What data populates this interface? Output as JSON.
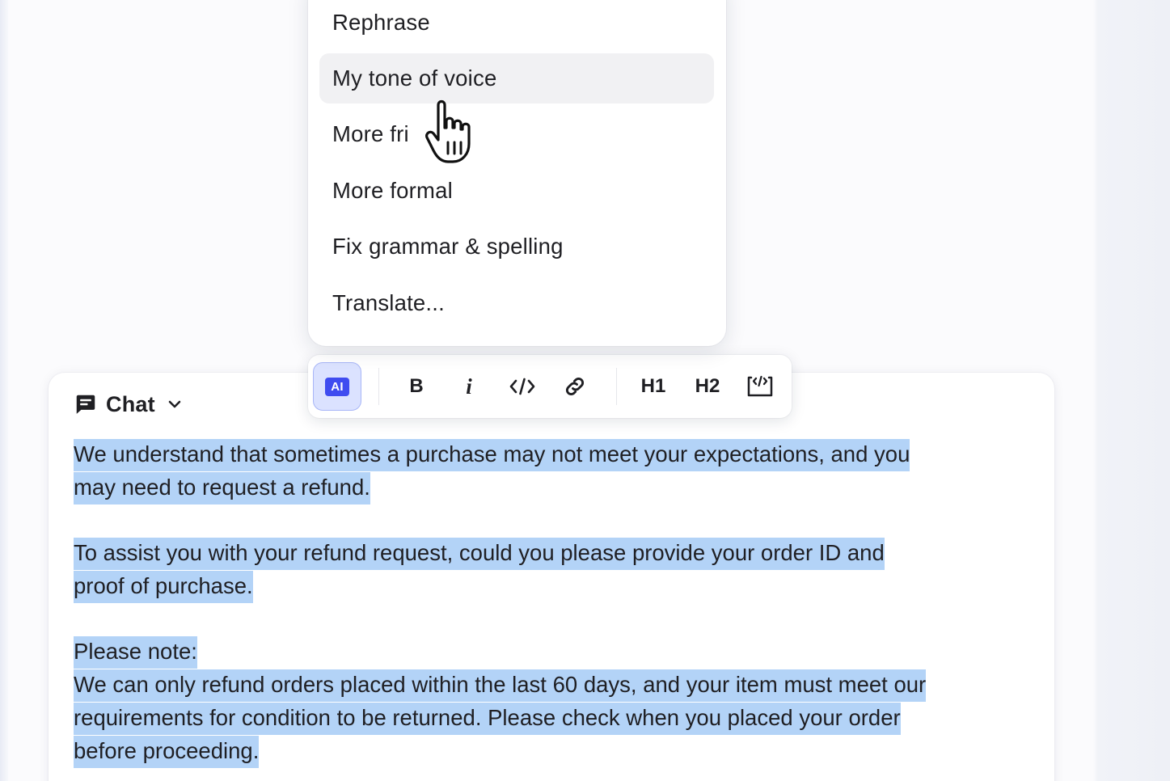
{
  "menu": {
    "items": [
      {
        "label": "Rephrase"
      },
      {
        "label": "My tone of voice"
      },
      {
        "label": "More fri"
      },
      {
        "label": "More formal"
      },
      {
        "label": "Fix grammar & spelling"
      },
      {
        "label": "Translate..."
      }
    ],
    "hovered_item": "My tone of voice"
  },
  "toolbar": {
    "ai_label": "AI",
    "bold_label": "B",
    "italic_label": "i",
    "h1_label": "H1",
    "h2_label": "H2",
    "icons": [
      "ai-icon",
      "bold-icon",
      "italic-icon",
      "code-icon",
      "link-icon",
      "h1-icon",
      "h2-icon",
      "code-block-icon"
    ],
    "accent_color": "#3f4cf0"
  },
  "composer": {
    "channel_label": "Chat",
    "channel_icon": "chat-bubble-icon",
    "paragraphs": [
      {
        "lines": [
          "We understand that sometimes a purchase may not meet your expectations, and you",
          "may need to request a refund."
        ]
      },
      {
        "lines": [
          "To assist you with your refund request, could you please provide your order ID and",
          "proof of purchase."
        ]
      },
      {
        "lines": [
          "Please note:",
          "We can only refund orders placed within the last 60 days, and your item must meet our",
          "requirements for condition to be returned. Please check when you placed your order",
          "before proceeding."
        ]
      }
    ],
    "selection_color": "#b3d3f7"
  }
}
